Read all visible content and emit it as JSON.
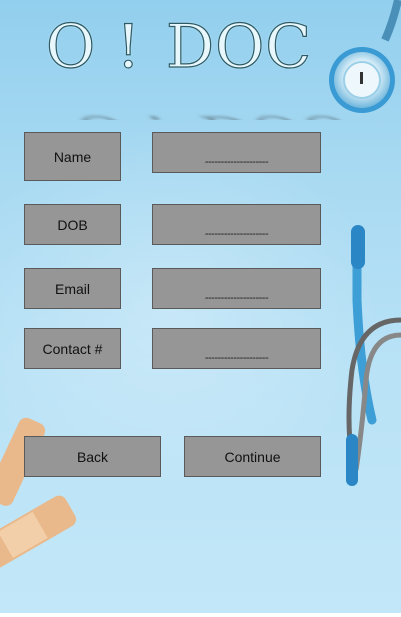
{
  "logo": {
    "left_text": "O !",
    "right_text": "DOC"
  },
  "form": {
    "fields": [
      {
        "label": "Name",
        "value": "--------------------"
      },
      {
        "label": "DOB",
        "value": "--------------------"
      },
      {
        "label": "Email",
        "value": "--------------------"
      },
      {
        "label": "Contact #",
        "value": "--------------------"
      }
    ]
  },
  "actions": {
    "back_label": "Back",
    "continue_label": "Continue"
  },
  "colors": {
    "background": "#a9daf2",
    "button_fill": "#969696",
    "button_border": "#5a5a5a"
  },
  "icons": [
    "stethoscope-icon",
    "bandage-icon"
  ]
}
